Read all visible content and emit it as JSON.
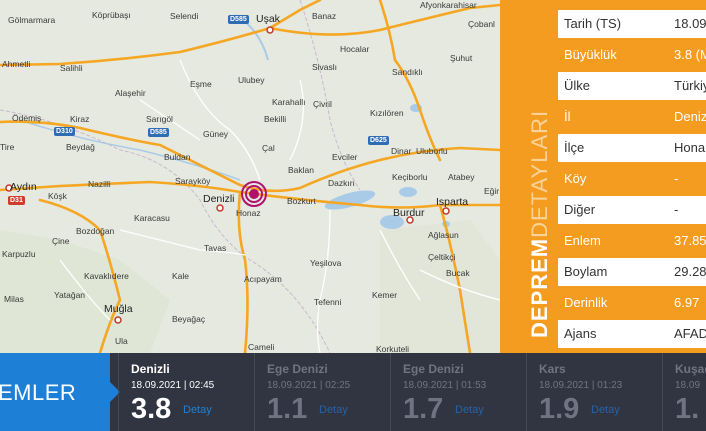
{
  "map": {
    "places": [
      {
        "name": "Gölmarmara",
        "cls": ""
      },
      {
        "name": "Köprübaşı",
        "cls": ""
      },
      {
        "name": "Selendi",
        "cls": ""
      },
      {
        "name": "Uşak",
        "cls": "big"
      },
      {
        "name": "Banaz",
        "cls": ""
      },
      {
        "name": "Afyonkarahisar",
        "cls": ""
      },
      {
        "name": "Çobanl",
        "cls": ""
      },
      {
        "name": "Salihli",
        "cls": ""
      },
      {
        "name": "Ahmetli",
        "cls": ""
      },
      {
        "name": "Eşme",
        "cls": ""
      },
      {
        "name": "Ulubey",
        "cls": ""
      },
      {
        "name": "Sivaslı",
        "cls": ""
      },
      {
        "name": "Hocalar",
        "cls": ""
      },
      {
        "name": "Şuhut",
        "cls": ""
      },
      {
        "name": "Sandıklı",
        "cls": ""
      },
      {
        "name": "Alaşehir",
        "cls": ""
      },
      {
        "name": "Karahallı",
        "cls": ""
      },
      {
        "name": "Çivril",
        "cls": ""
      },
      {
        "name": "Ödemiş",
        "cls": ""
      },
      {
        "name": "Kiraz",
        "cls": ""
      },
      {
        "name": "Sarıgöl",
        "cls": ""
      },
      {
        "name": "Bekilli",
        "cls": ""
      },
      {
        "name": "Kızılören",
        "cls": ""
      },
      {
        "name": "Tire",
        "cls": ""
      },
      {
        "name": "Beydağ",
        "cls": ""
      },
      {
        "name": "Güney",
        "cls": ""
      },
      {
        "name": "Çal",
        "cls": ""
      },
      {
        "name": "Dinar",
        "cls": ""
      },
      {
        "name": "Uluborlu",
        "cls": ""
      },
      {
        "name": "Buldan",
        "cls": ""
      },
      {
        "name": "Baklan",
        "cls": ""
      },
      {
        "name": "Evciler",
        "cls": ""
      },
      {
        "name": "Keçiborlu",
        "cls": ""
      },
      {
        "name": "Atabey",
        "cls": ""
      },
      {
        "name": "Aydın",
        "cls": "big"
      },
      {
        "name": "Nazilli",
        "cls": ""
      },
      {
        "name": "Sarayköy",
        "cls": ""
      },
      {
        "name": "Denizli",
        "cls": "big"
      },
      {
        "name": "Dazkırı",
        "cls": ""
      },
      {
        "name": "Bozkurt",
        "cls": ""
      },
      {
        "name": "Honaz",
        "cls": ""
      },
      {
        "name": "Burdur",
        "cls": "big"
      },
      {
        "name": "Isparta",
        "cls": "big"
      },
      {
        "name": "Köşk",
        "cls": ""
      },
      {
        "name": "Karacasu",
        "cls": ""
      },
      {
        "name": "Ağlasun",
        "cls": ""
      },
      {
        "name": "Bozdoğan",
        "cls": ""
      },
      {
        "name": "Çine",
        "cls": ""
      },
      {
        "name": "Tavas",
        "cls": ""
      },
      {
        "name": "Çeltikçi",
        "cls": ""
      },
      {
        "name": "Karpuzlu",
        "cls": ""
      },
      {
        "name": "Yeşilova",
        "cls": ""
      },
      {
        "name": "Bucak",
        "cls": ""
      },
      {
        "name": "Kavaklıdere",
        "cls": ""
      },
      {
        "name": "Kale",
        "cls": ""
      },
      {
        "name": "Acıpayam",
        "cls": ""
      },
      {
        "name": "Milas",
        "cls": ""
      },
      {
        "name": "Yatağan",
        "cls": ""
      },
      {
        "name": "Tefenni",
        "cls": ""
      },
      {
        "name": "Kemer",
        "cls": ""
      },
      {
        "name": "Muğla",
        "cls": "big"
      },
      {
        "name": "Beyağaç",
        "cls": ""
      },
      {
        "name": "Ula",
        "cls": ""
      },
      {
        "name": "Cameli",
        "cls": ""
      },
      {
        "name": "Korkuteli",
        "cls": ""
      },
      {
        "name": "Eğir",
        "cls": ""
      }
    ],
    "roads": [
      "D585",
      "D310",
      "D585",
      "D625",
      "D31",
      "D650"
    ]
  },
  "panel": {
    "vertical_bold": "DEPREM",
    "vertical_light": "DETAYLARI",
    "rows": [
      {
        "label": "Tarih (TS)",
        "value": "18.09",
        "style": "w"
      },
      {
        "label": "Büyüklük",
        "value": "3.8 (M",
        "style": "o"
      },
      {
        "label": "Ülke",
        "value": "Türkiy",
        "style": "w"
      },
      {
        "label": "İl",
        "value": "Denizl",
        "style": "o"
      },
      {
        "label": "İlçe",
        "value": "Hona",
        "style": "w"
      },
      {
        "label": "Köy",
        "value": "-",
        "style": "o"
      },
      {
        "label": "Diğer",
        "value": "-",
        "style": "w"
      },
      {
        "label": "Enlem",
        "value": "37.85",
        "style": "o"
      },
      {
        "label": "Boylam",
        "value": "29.28",
        "style": "w"
      },
      {
        "label": "Derinlik",
        "value": "6.97",
        "style": "o"
      },
      {
        "label": "Ajans",
        "value": "AFAD",
        "style": "w"
      }
    ]
  },
  "strip": {
    "title": "EMLER",
    "quakes": [
      {
        "location": "Denizli",
        "datetime": "18.09.2021 | 02:45",
        "magnitude": "3.8",
        "detail": "Detay",
        "state": "active"
      },
      {
        "location": "Ege Denizi",
        "datetime": "18.09.2021 | 02:25",
        "magnitude": "1.1",
        "detail": "Detay",
        "state": "dim"
      },
      {
        "location": "Ege Denizi",
        "datetime": "18.09.2021 | 01:53",
        "magnitude": "1.7",
        "detail": "Detay",
        "state": "dim"
      },
      {
        "location": "Kars",
        "datetime": "18.09.2021 | 01:23",
        "magnitude": "1.9",
        "detail": "Detay",
        "state": "dim"
      },
      {
        "location": "Kuşad",
        "datetime": "18.09",
        "magnitude": "1.",
        "detail": "",
        "state": "dim"
      }
    ]
  },
  "colors": {
    "accent_orange": "#f39c1f",
    "strip_bg": "#313541",
    "strip_title_bg": "#1e7fd6",
    "epicenter": "#b0126e"
  }
}
